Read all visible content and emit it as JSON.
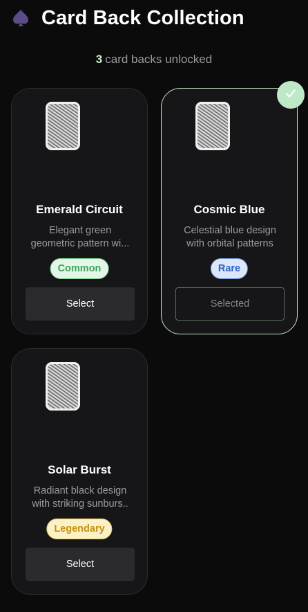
{
  "header": {
    "title": "Card Back Collection",
    "icon": "spade-icon"
  },
  "summary": {
    "count": "3",
    "text": "card backs unlocked"
  },
  "colors": {
    "accent_green": "#bfe8c6",
    "common": "#3fa45b",
    "rare": "#2f62c2",
    "legendary": "#c79214"
  },
  "cards": [
    {
      "name": "Emerald Circuit",
      "desc_line1": "Elegant green",
      "desc_line2": "geometric pattern wi...",
      "rarity": "Common",
      "button_label": "Select",
      "selected": false
    },
    {
      "name": "Cosmic Blue",
      "desc_line1": "Celestial blue design",
      "desc_line2": "with orbital patterns",
      "rarity": "Rare",
      "button_label": "Selected",
      "selected": true
    },
    {
      "name": "Solar Burst",
      "desc_line1": "Radiant black design",
      "desc_line2": "with striking sunburs..",
      "rarity": "Legendary",
      "button_label": "Select",
      "selected": false
    }
  ]
}
